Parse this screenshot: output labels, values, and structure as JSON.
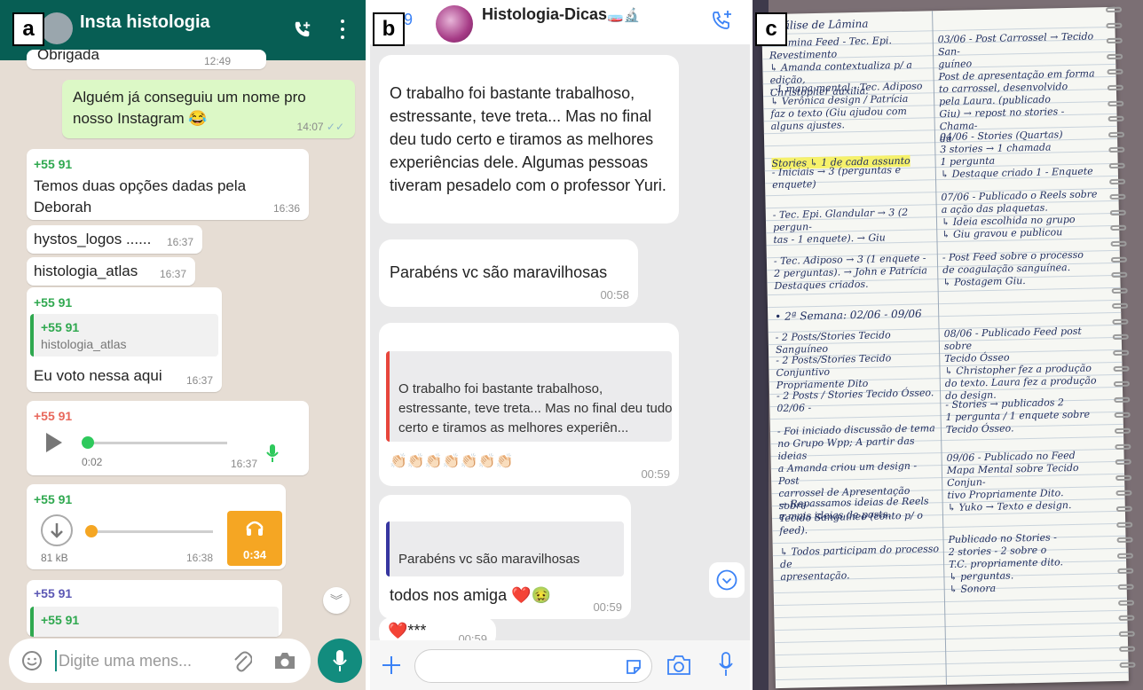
{
  "labels": {
    "a": "a",
    "b": "b",
    "c": "c"
  },
  "whatsapp": {
    "title": "Insta histologia",
    "top_partial": "Obrigada",
    "top_partial_time": "12:49",
    "messages": [
      {
        "text": "Alguém já conseguiu um nome pro nosso Instagram 😂",
        "time": "14:07"
      },
      {
        "sender": "+55 91",
        "text": "Temos duas opções dadas pela Deborah",
        "time": "16:36"
      },
      {
        "text": "hystos_logos ......",
        "time": "16:37"
      },
      {
        "text": "histologia_atlas",
        "time": "16:37"
      },
      {
        "sender": "+55 91",
        "quote_sender": "+55 91",
        "quote_text": "histologia_atlas",
        "text": "Eu voto nessa aqui",
        "time": "16:37"
      },
      {
        "sender": "+55 91",
        "duration": "0:02",
        "time": "16:37"
      },
      {
        "sender": "+55 91",
        "size": "81 kB",
        "time": "16:38",
        "length": "0:34"
      },
      {
        "sender": "+55 91",
        "quote_sender": "+55 91"
      }
    ],
    "input_placeholder": "Digite uma mens..."
  },
  "instagram": {
    "back_count": "9",
    "title": "Histologia-Dicas",
    "title_emoji": "🧫🔬",
    "messages": [
      {
        "text": "O trabalho foi bastante trabalhoso, estressante, teve treta... Mas no final deu tudo certo e tiramos as melhores experiências dele. Algumas pessoas tiveram pesadelo com o professor Yuri."
      },
      {
        "text": "Parabéns vc são maravilhosas",
        "time": "00:58"
      },
      {
        "quote": "O trabalho foi bastante trabalhoso, estressante, teve treta... Mas no final deu tudo certo e tiramos as melhores experiên...",
        "text": "👏🏻👏🏻👏🏻👏🏻👏🏻👏🏻👏🏻",
        "time": "00:59"
      },
      {
        "quote": "Parabéns vc são maravilhosas",
        "text": "todos nos amiga ❤️🤢",
        "time": "00:59"
      },
      {
        "text": "❤️***",
        "time": "00:59"
      }
    ]
  },
  "notebook": {
    "left_col": [
      "Análise de Lâmina",
      "- Lâmina Feed - Tec. Epi. Revestimento\n↳ Amanda contextualiza p/ a edição,\n   Christopher auxilia.",
      "- 1 mapa mental - Tec. Adiposo\n↳ Verônica design / Patrícia\n   faz o texto (Giu ajudou com\n   alguns ajustes.",
      "Stories  ↳ 1 de cada assunto",
      "- Iniciais → 3 (perguntas e enquete)",
      "- Tec. Epi. Glandular → 3 (2 pergun-\n  tas - 1 enquete). → Giu",
      "- Tec. Adiposo → 3 (1 enquete -\n  2 perguntas). → John e Patrícia\n  Destaques criados.",
      "• 2ª Semana: 02/06 - 09/06",
      "- 2 Posts/Stories Tecido Sanguíneo",
      "- 2 Posts/Stories Tecido Conjuntivo\n  Propriamente Dito",
      "- 2 Posts / Stories Tecido Ósseo.\n02/06 -",
      "- Foi iniciado discussão de tema\n  no Grupo Wpp; A partir das ideias\n  a Amanda criou um design - Post\n  carrossel de Apresentação sobre\n  Tecido Sanguíneo (conto p/ o feed).",
      "→ Repassamos ideias de Reels\n  e mais ideias de posts.",
      "↳ Todos participam do processo de\n  apresentação."
    ],
    "right_col": [
      "03/06 - Post Carrossel → Tecido San-\nguíneo\n  Post de apresentação em forma\n  to carrossel, desenvolvido\n  pela Laura. (publicado\n  Giu) → repost no stories - Chama-\n  da",
      "04/06 - Stories (Quartas)\n  3 stories → 1 chamada\n               1 pergunta\n↳ Destaque criado  1 - Enquete",
      "07/06 - Publicado o Reels sobre\n  a ação das plaquetas.\n  ↳ Ideia escolhida no grupo\n  ↳ Giu gravou e publicou",
      "- Post Feed sobre o processo\n  de coagulação sanguínea.\n  ↳ Postagem Giu.",
      "08/06 - Publicado Feed post sobre\n  Tecido Ósseo\n  ↳ Christopher fez a produção\n  do texto. Laura fez a produção\n  do design.",
      "- Stories → publicados 2\n  1 pergunta / 1 enquete sobre\n  Tecido Ósseo.",
      "09/06 - Publicado no Feed\n  Mapa Mental sobre Tecido Conjun-\n  tivo Propriamente Dito.\n  ↳ Yuko → Texto e design.",
      "Publicado no Stories -\n  2 stories - 2 sobre o\n  T.C. propriamente dito.\n  ↳ perguntas.\n  ↳ Sonora"
    ]
  }
}
